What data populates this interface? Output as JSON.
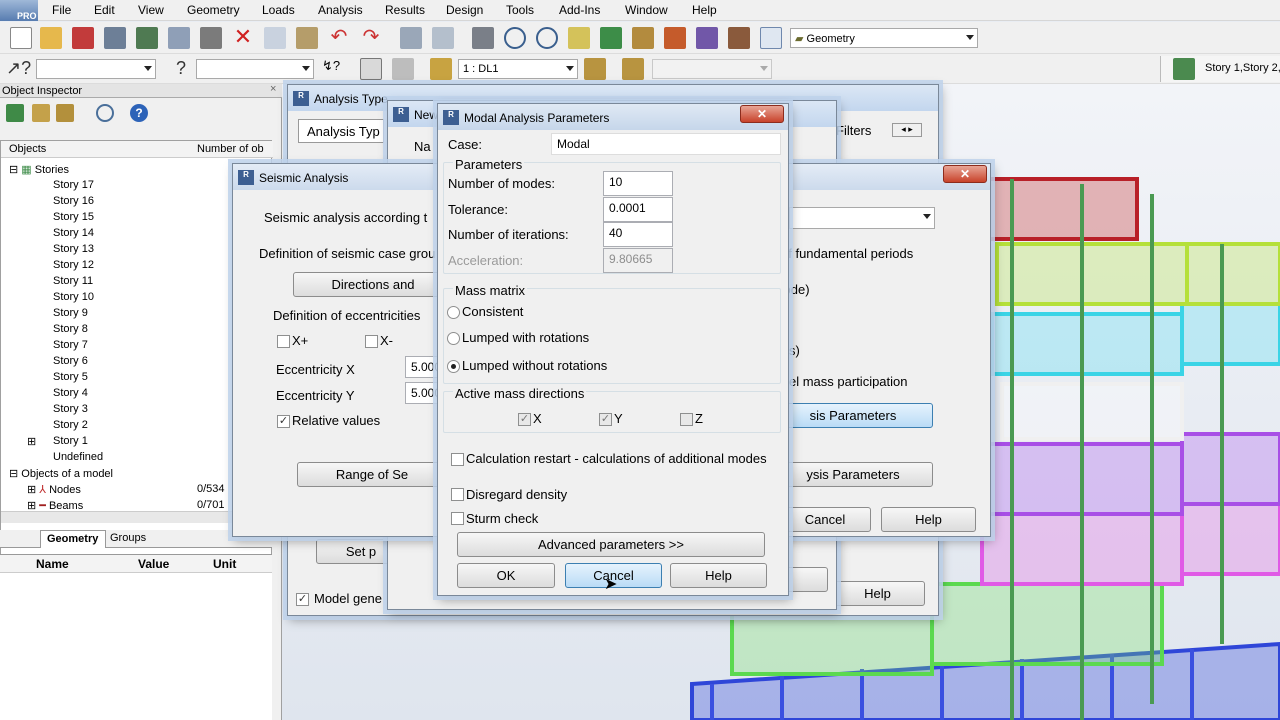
{
  "menu": [
    "File",
    "Edit",
    "View",
    "Geometry",
    "Loads",
    "Analysis",
    "Results",
    "Design",
    "Tools",
    "Add-Ins",
    "Window",
    "Help"
  ],
  "logo_text": "PRO",
  "toolbar": {
    "layout_combo": "Geometry",
    "load_case_combo": "1 : DL1",
    "story_combo": "Story 1,Story 2,S"
  },
  "inspector": {
    "title": "Object Inspector",
    "col_objects": "Objects",
    "col_number": "Number of ob",
    "stories_label": "Stories",
    "stories": [
      "Story 17",
      "Story 16",
      "Story 15",
      "Story 14",
      "Story 13",
      "Story 12",
      "Story 11",
      "Story 10",
      "Story 9",
      "Story 8",
      "Story 7",
      "Story 6",
      "Story 5",
      "Story 4",
      "Story 3",
      "Story 2",
      "Story 1",
      "Undefined"
    ],
    "objects_label": "Objects of a model",
    "nodes_label": "Nodes",
    "nodes_count": "0/534",
    "beams_label": "Beams",
    "beams_count": "0/701",
    "tab_geometry": "Geometry",
    "tab_groups": "Groups",
    "prop_name": "Name",
    "prop_value": "Value",
    "prop_unit": "Unit"
  },
  "analysis_type": {
    "title": "Analysis Type",
    "tab": "Analysis Typ",
    "filters": "Filters",
    "model_gen": "Model gene",
    "help": "Help",
    "set_btn": "Set p"
  },
  "new_case": {
    "title": "New",
    "name_label": "Na"
  },
  "seismic": {
    "title": "Seismic Analysis",
    "according": "Seismic analysis according t",
    "definition_group": "Definition of seismic case grou",
    "fundamental": "of fundamental periods",
    "directions_btn": "Directions and",
    "code_text": "code)",
    "eccentricities": "Definition of eccentricities",
    "xplus": "X+",
    "xminus": "X-",
    "ecc_x_label": "Eccentricity X",
    "ecc_x_val": "5.000",
    "ecc_y_label": "Eccentricity Y",
    "ecc_y_val": "5.000",
    "relative": "Relative values",
    "paren_s": "s)",
    "mass_participation": "el mass participation",
    "analysis_params_btn": "sis Parameters",
    "range_btn": "Range of Se",
    "analysis_params_btn2": "ysis Parameters",
    "cancel": "Cancel",
    "help": "Help"
  },
  "modal": {
    "title": "Modal Analysis Parameters",
    "case_label": "Case:",
    "case_value": "Modal",
    "parameters": "Parameters",
    "modes_label": "Number of modes:",
    "modes_value": "10",
    "tol_label": "Tolerance:",
    "tol_value": "0.0001",
    "iter_label": "Number of iterations:",
    "iter_value": "40",
    "accel_label": "Acceleration:",
    "accel_value": "9.80665",
    "mass_matrix": "Mass matrix",
    "consistent": "Consistent",
    "lumped_rot": "Lumped with rotations",
    "lumped_norot": "Lumped without rotations",
    "active_dirs": "Active mass directions",
    "dir_x": "X",
    "dir_y": "Y",
    "dir_z": "Z",
    "restart": "Calculation restart - calculations of additional modes",
    "disregard": "Disregard density",
    "sturm": "Sturm check",
    "advanced": "Advanced parameters >>",
    "ok": "OK",
    "cancel": "Cancel",
    "help": "Help"
  }
}
